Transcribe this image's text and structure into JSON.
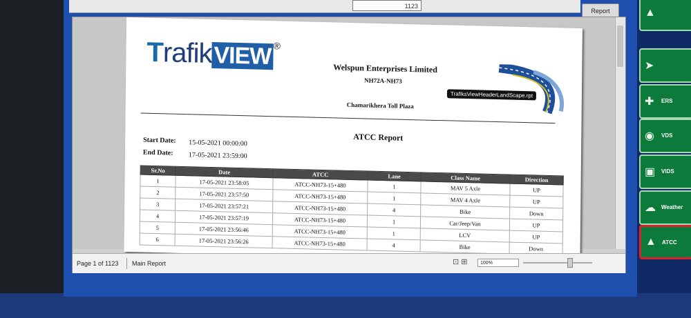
{
  "viewer": {
    "page_combo": "1123",
    "report_button": "Report",
    "zoom": "100%",
    "status": {
      "page": "Page 1 of 1123",
      "tab": "Main Report"
    }
  },
  "report": {
    "logo": {
      "t": "T",
      "rafik": "rafik",
      "view": "VIEW",
      "reg": "®"
    },
    "company": "Welspun Enterprises Limited",
    "highway": "NH72A-NH73",
    "plaza": "Chamarikhera Toll Plaza",
    "tooltip": "TrafiksViewHeaderLandScape.rpt",
    "title": "ATCC Report",
    "start_label": "Start Date:",
    "start_value": "15-05-2021  00:00:00",
    "end_label": "End Date:",
    "end_value": "17-05-2021  23:59:00",
    "columns": [
      "Sr.No",
      "Date",
      "ATCC",
      "Lane",
      "Class Name",
      "Direction"
    ],
    "rows": [
      [
        "1",
        "17-05-2021  23:58:05",
        "ATCC-NH73-15+480",
        "1",
        "MAV 5 Axle",
        "UP"
      ],
      [
        "2",
        "17-05-2021  23:57:50",
        "ATCC-NH73-15+480",
        "1",
        "MAV 4 Axle",
        "UP"
      ],
      [
        "3",
        "17-05-2021  23:57:21",
        "ATCC-NH73-15+480",
        "4",
        "Bike",
        "Down"
      ],
      [
        "4",
        "17-05-2021  23:57:19",
        "ATCC-NH73-15+480",
        "1",
        "Car/Jeep/Van",
        "UP"
      ],
      [
        "5",
        "17-05-2021  23:56:46",
        "ATCC-NH73-15+480",
        "1",
        "LCV",
        "UP"
      ],
      [
        "6",
        "17-05-2021  23:56:26",
        "ATCC-NH73-15+480",
        "4",
        "Bike",
        "Down"
      ]
    ]
  },
  "sidebar": {
    "items": [
      {
        "label": "",
        "icon": "road-icon"
      },
      {
        "label": "",
        "icon": "cursor-icon"
      },
      {
        "label": "ERS",
        "icon": "alarm-icon"
      },
      {
        "label": "VDS",
        "icon": "camera-icon"
      },
      {
        "label": "VIDS",
        "icon": "monitor-icon"
      },
      {
        "label": "Weather",
        "icon": "cloud-icon"
      },
      {
        "label": "ATCC",
        "icon": "vehicle-icon"
      }
    ]
  }
}
